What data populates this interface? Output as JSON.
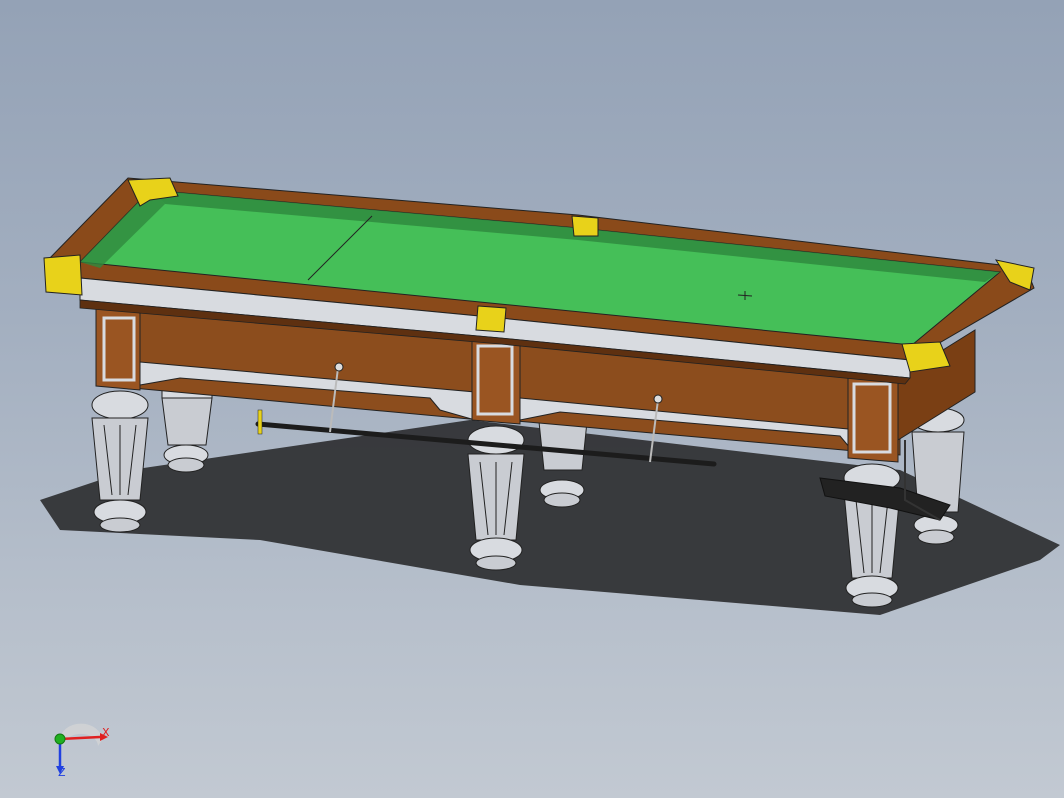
{
  "viewport": {
    "background_top": "#94a2b6",
    "background_bottom": "#c2c9d2"
  },
  "model": {
    "felt_color": "#45bf58",
    "felt_shadow": "#2f8a3e",
    "rail_wood": "#8a4a1a",
    "rail_wood_dark": "#5e3010",
    "apron_wood": "#8c4d1d",
    "pocket_brass": "#e8d21a",
    "leg_color": "#c9ccd2",
    "trim_silver": "#d8dbe0",
    "cue_color": "#1c1c1c",
    "shadow_color": "#2e2f31"
  },
  "triad": {
    "x_label": "X",
    "z_label": "Z",
    "x_color": "#e02020",
    "y_color": "#20b020",
    "z_color": "#2040e0"
  }
}
